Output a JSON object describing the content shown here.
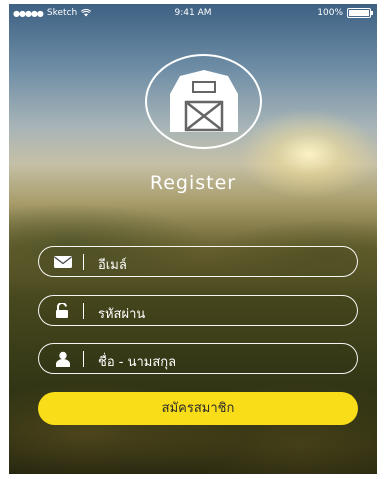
{
  "status_bar": {
    "carrier": "Sketch",
    "time": "9:41 AM",
    "battery": "100%"
  },
  "brand": {
    "logo_icon": "barn-icon",
    "title": "Register"
  },
  "form": {
    "email": {
      "icon": "mail-icon",
      "placeholder": "อีเมล์"
    },
    "password": {
      "icon": "unlock-icon",
      "placeholder": "รหัสผ่าน"
    },
    "name": {
      "icon": "user-icon",
      "placeholder": "ชื่อ - นามสกุล"
    },
    "submit_label": "สมัครสมาชิก"
  },
  "colors": {
    "button": "#f9dd18",
    "text": "#ffffff"
  }
}
